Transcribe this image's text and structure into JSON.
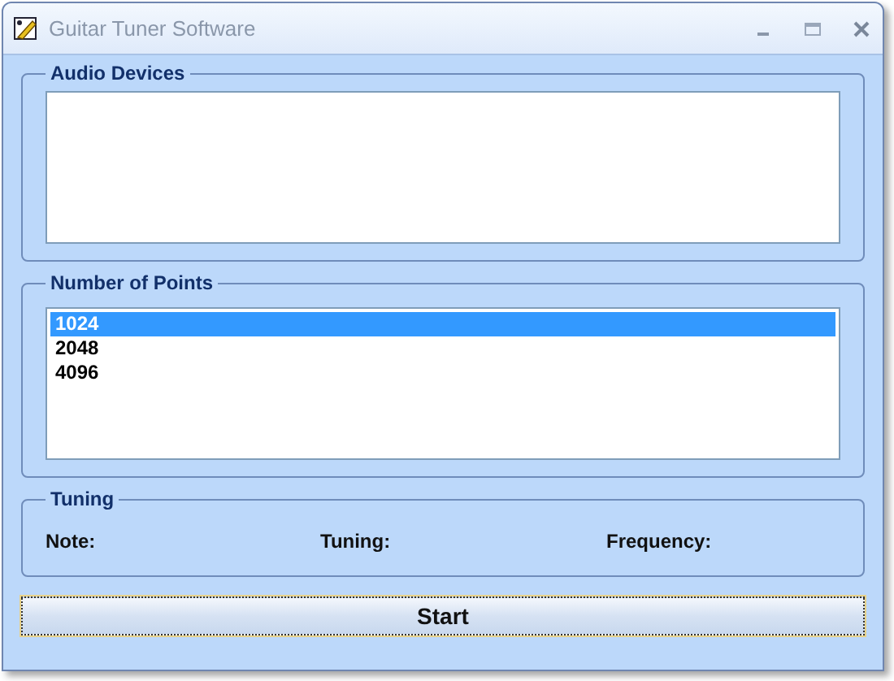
{
  "window": {
    "title": "Guitar Tuner Software"
  },
  "audio_devices": {
    "title": "Audio Devices"
  },
  "number_of_points": {
    "title": "Number of Points",
    "items": [
      {
        "label": "1024",
        "selected": true
      },
      {
        "label": "2048",
        "selected": false
      },
      {
        "label": "4096",
        "selected": false
      }
    ]
  },
  "tuning": {
    "title": "Tuning",
    "labels": [
      "Note:",
      "Tuning:",
      "Frequency:"
    ]
  },
  "buttons": [
    "Start"
  ]
}
